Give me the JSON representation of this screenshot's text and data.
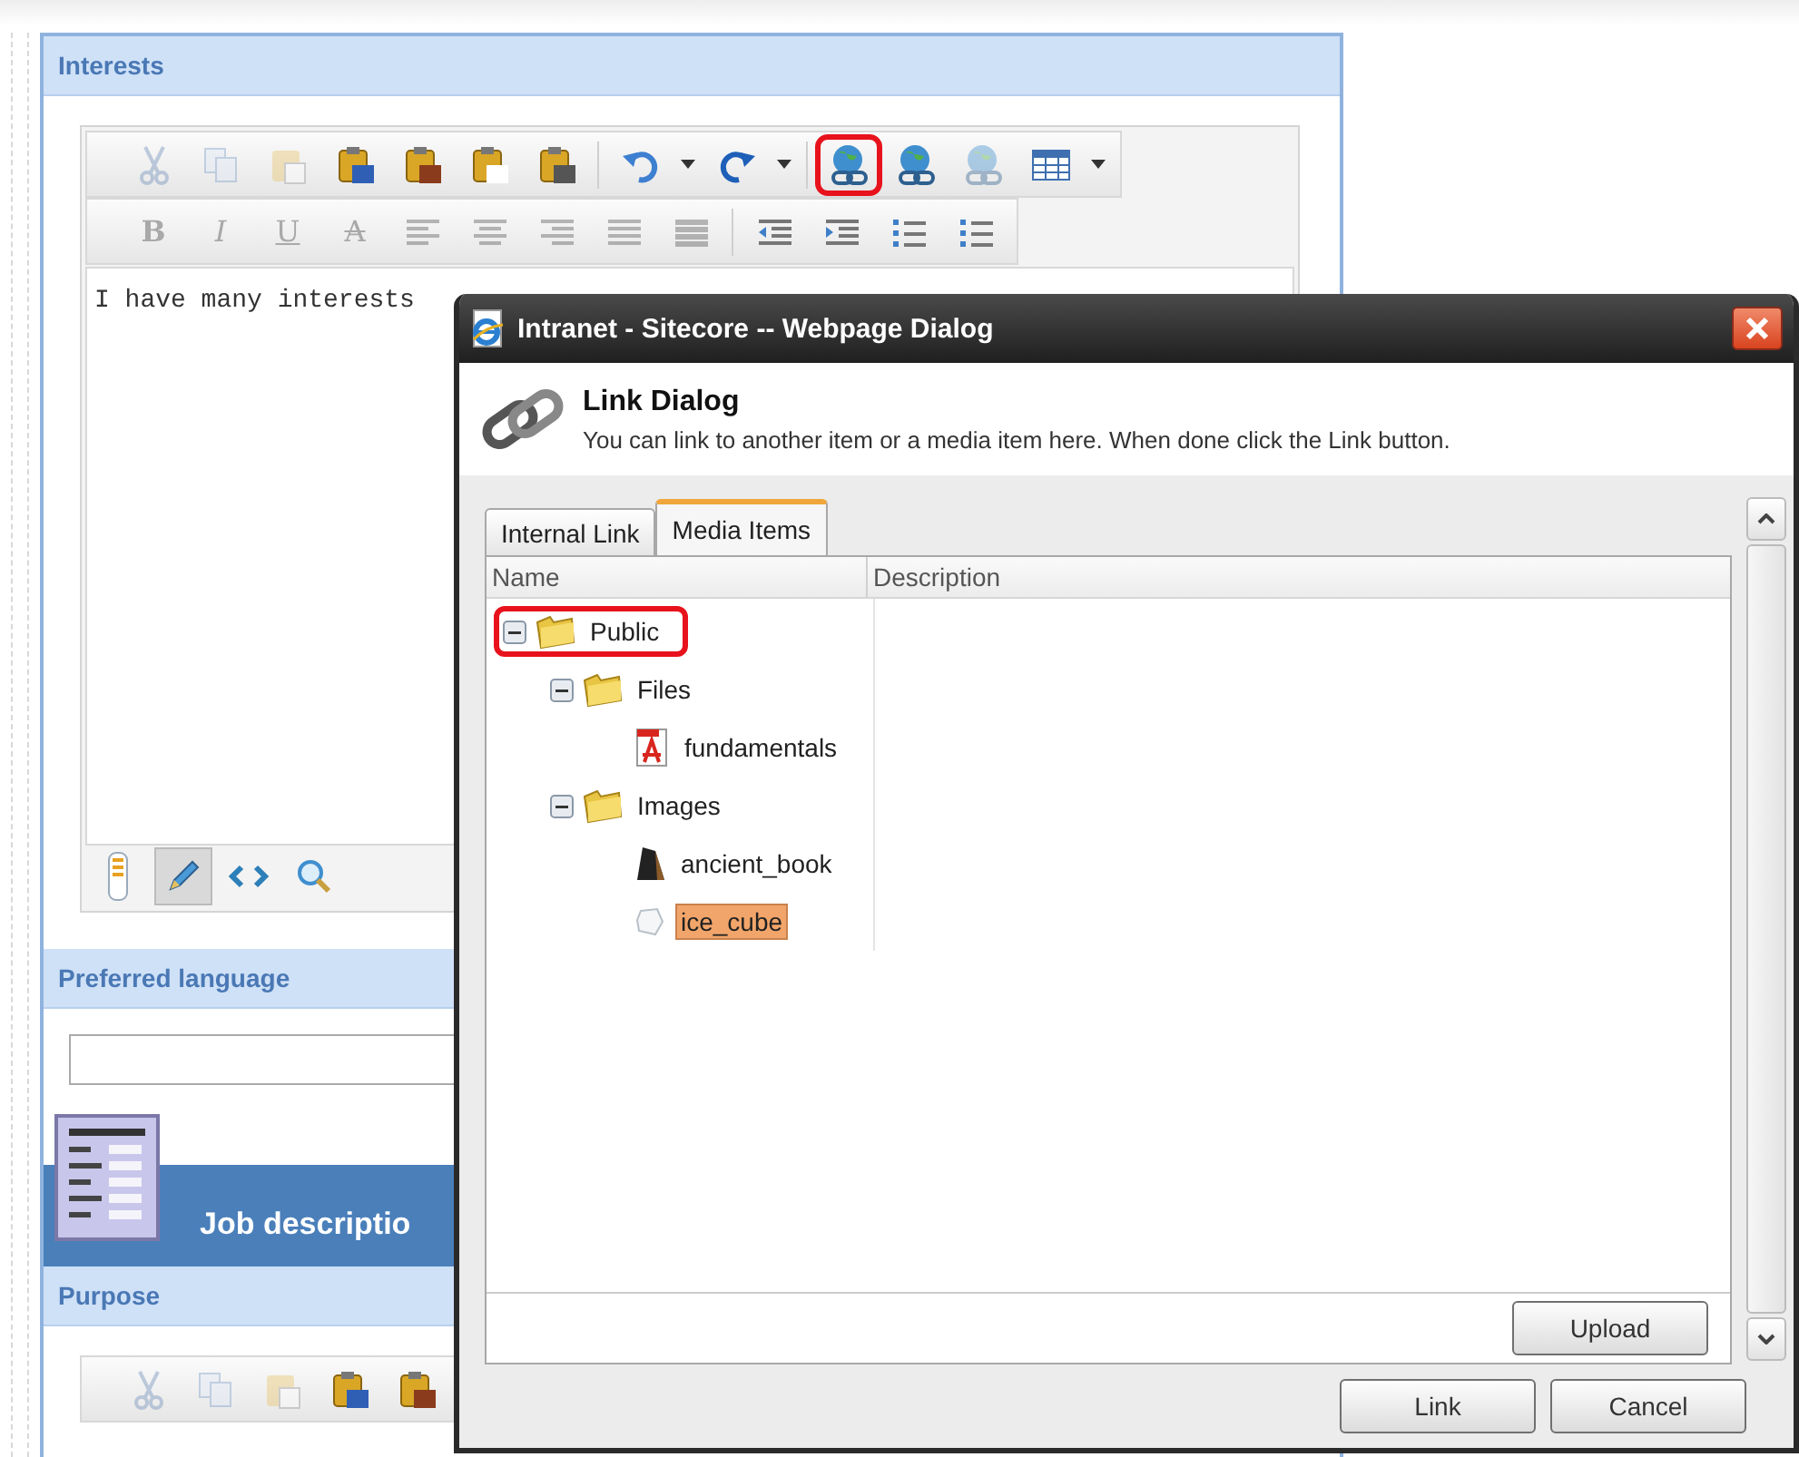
{
  "editor_page": {
    "interests": {
      "title": "Interests",
      "content": "I have many interests"
    },
    "toolbar_1": [
      {
        "kind": "cut",
        "disabled": true,
        "highlighted": false
      },
      {
        "kind": "copy",
        "disabled": true,
        "highlighted": false
      },
      {
        "kind": "paste",
        "disabled": true,
        "highlighted": false
      },
      {
        "kind": "paste-word",
        "disabled": false,
        "highlighted": false
      },
      {
        "kind": "paste-word-alt",
        "disabled": false,
        "highlighted": false
      },
      {
        "kind": "paste-plain",
        "disabled": false,
        "highlighted": false
      },
      {
        "kind": "paste-html",
        "disabled": false,
        "highlighted": false
      },
      {
        "kind": "separator"
      },
      {
        "kind": "undo",
        "disabled": false,
        "highlighted": false
      },
      {
        "kind": "caret",
        "disabled": false,
        "highlighted": false
      },
      {
        "kind": "redo",
        "disabled": false,
        "highlighted": false
      },
      {
        "kind": "caret",
        "disabled": false,
        "highlighted": false
      },
      {
        "kind": "separator"
      },
      {
        "kind": "link",
        "disabled": false,
        "highlighted": true
      },
      {
        "kind": "link",
        "disabled": false,
        "highlighted": false
      },
      {
        "kind": "link",
        "disabled": true,
        "highlighted": false
      },
      {
        "kind": "table",
        "disabled": false,
        "highlighted": false
      },
      {
        "kind": "caret",
        "disabled": false,
        "highlighted": false
      }
    ],
    "toolbar_2": [
      {
        "kind": "bold",
        "label": "B",
        "disabled": true
      },
      {
        "kind": "italic",
        "label": "I",
        "disabled": true
      },
      {
        "kind": "underline",
        "label": "U",
        "disabled": true
      },
      {
        "kind": "strike",
        "label": "A",
        "disabled": true
      },
      {
        "kind": "align-left",
        "disabled": true
      },
      {
        "kind": "align-center",
        "disabled": true
      },
      {
        "kind": "align-right",
        "disabled": true
      },
      {
        "kind": "justify",
        "disabled": true
      },
      {
        "kind": "justify-all",
        "disabled": true
      },
      {
        "kind": "separator"
      },
      {
        "kind": "outdent",
        "disabled": false
      },
      {
        "kind": "indent",
        "disabled": false
      },
      {
        "kind": "numbered-list",
        "disabled": false
      },
      {
        "kind": "bulleted-list",
        "disabled": false
      }
    ],
    "modes": [
      {
        "kind": "split",
        "selected": false
      },
      {
        "kind": "pencil",
        "selected": true
      },
      {
        "kind": "code",
        "selected": false
      },
      {
        "kind": "zoom",
        "selected": false
      }
    ],
    "preferred_language": {
      "title": "Preferred language"
    },
    "job": {
      "title": "Job descriptio"
    },
    "purpose": {
      "title": "Purpose",
      "toolbar": [
        {
          "kind": "cut",
          "disabled": true,
          "highlighted": false
        },
        {
          "kind": "copy",
          "disabled": true,
          "highlighted": false
        },
        {
          "kind": "paste",
          "disabled": true,
          "highlighted": false
        },
        {
          "kind": "paste-word",
          "disabled": false,
          "highlighted": false
        },
        {
          "kind": "paste-word-alt",
          "disabled": false,
          "highlighted": false
        }
      ]
    }
  },
  "dialog": {
    "title": "Intranet - Sitecore -- Webpage Dialog",
    "heading": "Link Dialog",
    "description": "You can link to another item or a media item here. When done click the Link button.",
    "tabs": [
      {
        "label": "Internal Link",
        "selected": false
      },
      {
        "label": "Media Items",
        "selected": true
      }
    ],
    "columns": [
      "Name",
      "Description"
    ],
    "tree": [
      {
        "label": "Public",
        "kind": "folder",
        "expanded": true,
        "selected": false,
        "highlighted": true,
        "children": [
          {
            "label": "Files",
            "kind": "folder",
            "expanded": true,
            "selected": false,
            "highlighted": false,
            "children": [
              {
                "label": "fundamentals",
                "kind": "pdf",
                "selected": false,
                "highlighted": false
              }
            ]
          },
          {
            "label": "Images",
            "kind": "folder",
            "expanded": true,
            "selected": false,
            "highlighted": false,
            "children": [
              {
                "label": "ancient_book",
                "kind": "dark-image",
                "selected": false,
                "highlighted": false
              },
              {
                "label": "ice_cube",
                "kind": "light-image",
                "selected": true,
                "highlighted": false
              }
            ]
          }
        ]
      }
    ],
    "upload_button": "Upload",
    "buttons": [
      "Link",
      "Cancel"
    ]
  }
}
